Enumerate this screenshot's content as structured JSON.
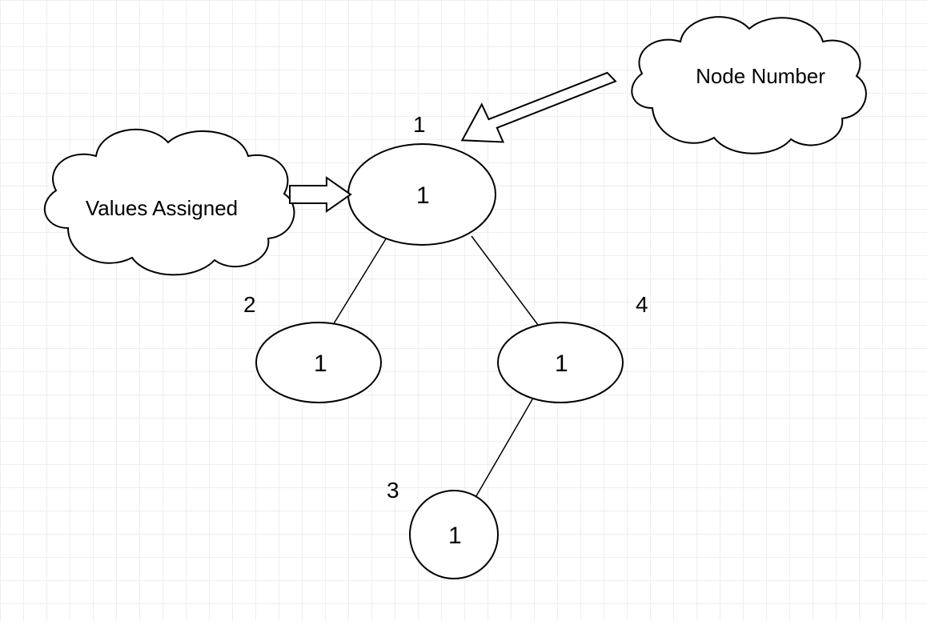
{
  "diagram": {
    "callouts": {
      "values_assigned": "Values Assigned",
      "node_number": "Node Number"
    },
    "nodes": {
      "n1": {
        "number": "1",
        "value": "1"
      },
      "n2": {
        "number": "2",
        "value": "1"
      },
      "n3": {
        "number": "3",
        "value": "1"
      },
      "n4": {
        "number": "4",
        "value": "1"
      }
    }
  }
}
